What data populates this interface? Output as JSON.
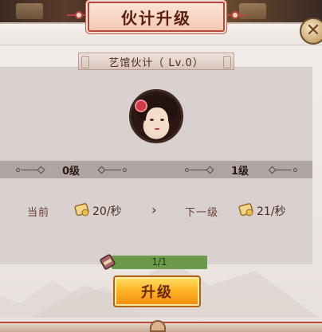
{
  "dialog": {
    "title": "伙计升级",
    "close_icon": "close-icon"
  },
  "worker": {
    "name": "艺馆伙计（ Lv.0）",
    "avatar_icon": "female-portrait"
  },
  "levels": {
    "current": "0级",
    "next": "1级"
  },
  "stats": {
    "current_label": "当前",
    "current_value": "20/秒",
    "next_label": "下一级",
    "next_value": "21/秒",
    "income_icon": "scroll-coin-icon",
    "arrow_icon": "chevron-right-icon"
  },
  "progress": {
    "text": "1/1",
    "fraction": 1.0,
    "icon": "scroll-item-icon"
  },
  "buttons": {
    "upgrade": "升级"
  },
  "colors": {
    "title_border": "#b8473d",
    "upgrade_button": "#ffb627",
    "progress_fill": "#6c9a4a"
  }
}
